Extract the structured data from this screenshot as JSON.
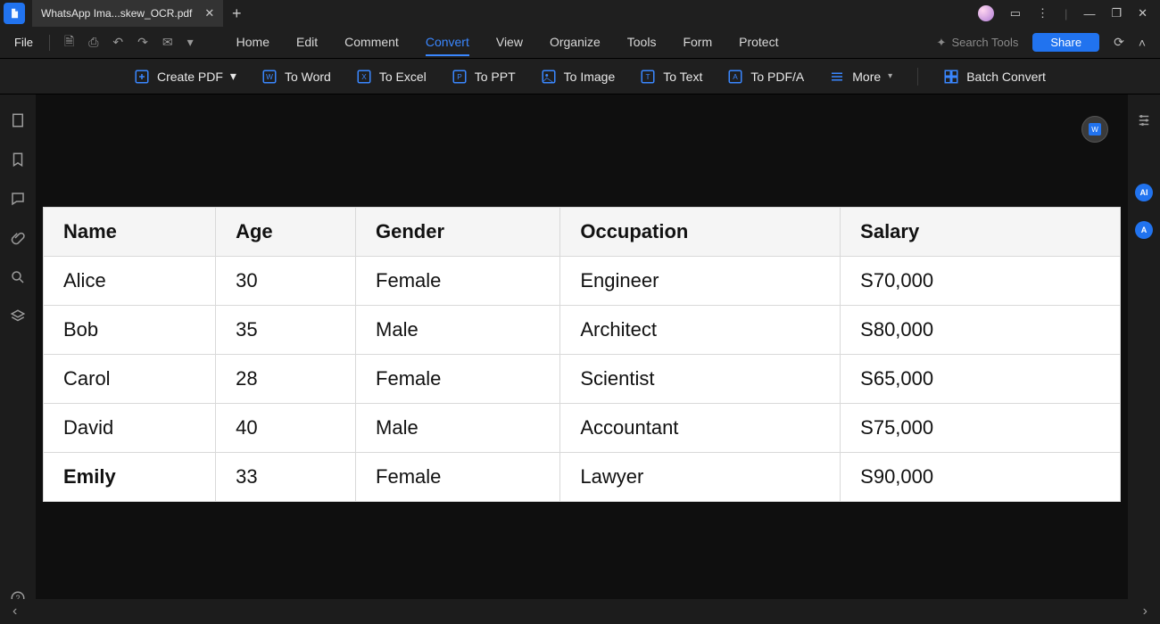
{
  "titlebar": {
    "tab_title": "WhatsApp Ima...skew_OCR.pdf"
  },
  "menu": {
    "file": "File",
    "items": [
      "Home",
      "Edit",
      "Comment",
      "Convert",
      "View",
      "Organize",
      "Tools",
      "Form",
      "Protect"
    ],
    "active_index": 3,
    "search_placeholder": "Search Tools",
    "share": "Share"
  },
  "ribbon": {
    "create_pdf": "Create PDF",
    "to_word": "To Word",
    "to_excel": "To Excel",
    "to_ppt": "To PPT",
    "to_image": "To Image",
    "to_text": "To Text",
    "to_pdfa": "To PDF/A",
    "more": "More",
    "batch": "Batch Convert"
  },
  "table": {
    "headers": [
      "Name",
      "Age",
      "Gender",
      "Occupation",
      "Salary"
    ],
    "rows": [
      {
        "name": "Alice",
        "age": "30",
        "gender": "Female",
        "occupation": "Engineer",
        "salary": "S70,000",
        "bold": false
      },
      {
        "name": "Bob",
        "age": "35",
        "gender": "Male",
        "occupation": "Architect",
        "salary": "S80,000",
        "bold": false
      },
      {
        "name": "Carol",
        "age": "28",
        "gender": "Female",
        "occupation": "Scientist",
        "salary": "S65,000",
        "bold": false
      },
      {
        "name": "David",
        "age": "40",
        "gender": "Male",
        "occupation": "Accountant",
        "salary": "S75,000",
        "bold": false
      },
      {
        "name": "Emily",
        "age": "33",
        "gender": "Female",
        "occupation": "Lawyer",
        "salary": "S90,000",
        "bold": true
      }
    ]
  },
  "right_badges": {
    "ai": "AI",
    "at": "A"
  }
}
